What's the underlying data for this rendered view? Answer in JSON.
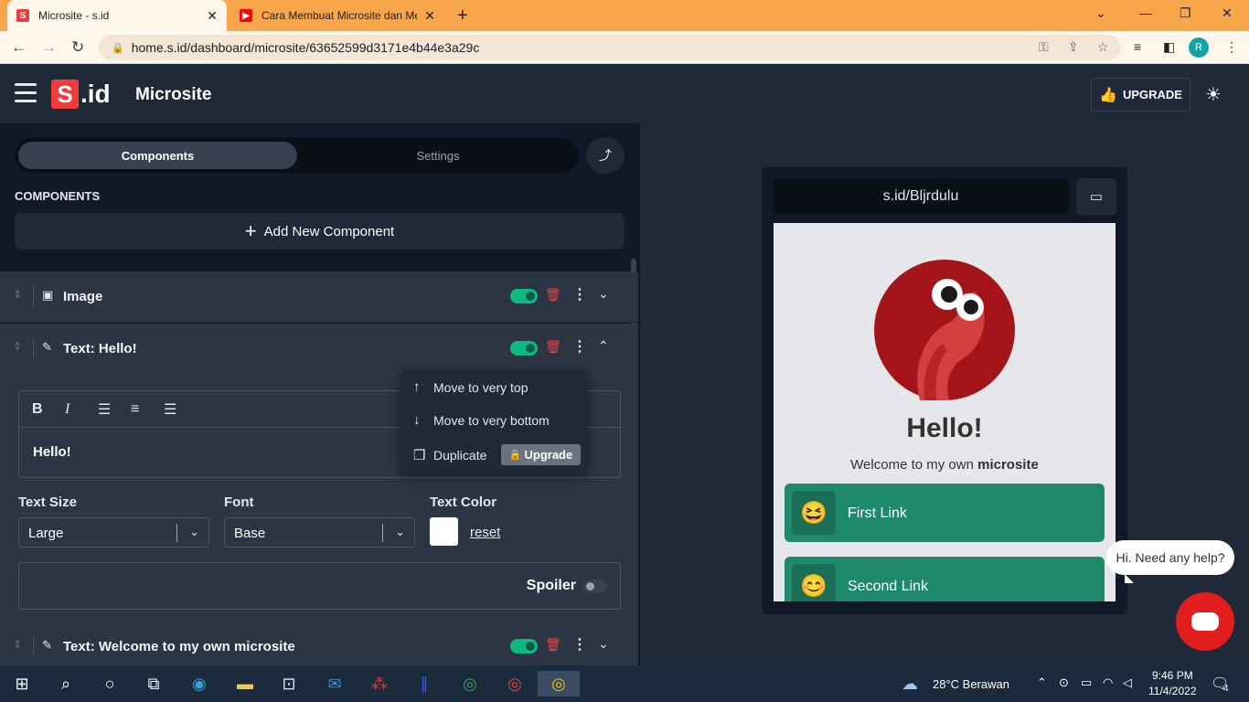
{
  "browser": {
    "tabs": [
      {
        "title": "Microsite - s.id",
        "favicon": "S",
        "favicon_color": "#ef3b3b"
      },
      {
        "title": "Cara Membuat Microsite dan Me",
        "favicon": "▶",
        "favicon_color": "#ff0000"
      }
    ],
    "url": "home.s.id/dashboard/microsite/63652599d3171e4b44e3a29c",
    "avatar_letter": "R"
  },
  "header": {
    "title": "Microsite",
    "logo_s": "S",
    "logo_id": ".id",
    "upgrade_label": "UPGRADE"
  },
  "panel": {
    "tabs": {
      "active": "Components",
      "inactive": "Settings"
    },
    "components_heading": "COMPONENTS",
    "add_button": "Add New Component",
    "rows": [
      {
        "label": "Image",
        "icon": "image-icon"
      },
      {
        "label": "Text: Hello!",
        "icon": "pencil-icon"
      },
      {
        "label": "Text: Welcome to my own microsite",
        "icon": "pencil-icon"
      }
    ],
    "editor_text": "Hello!",
    "text_size_label": "Text Size",
    "text_size_value": "Large",
    "font_label": "Font",
    "font_value": "Base",
    "text_color_label": "Text Color",
    "text_color_value": "#ffffff",
    "reset_label": "reset",
    "spoiler_label": "Spoiler"
  },
  "menu": {
    "move_top": "Move to very top",
    "move_bottom": "Move to very bottom",
    "duplicate": "Duplicate",
    "upgrade": "Upgrade"
  },
  "preview": {
    "url": "s.id/Bljrdulu",
    "heading": "Hello!",
    "welcome_prefix": "Welcome to my own ",
    "welcome_bold": "microsite",
    "links": [
      {
        "label": "First Link",
        "emoji": "😆"
      },
      {
        "label": "Second Link",
        "emoji": "😊"
      }
    ]
  },
  "chat": {
    "bubble": "Hi. Need any help?"
  },
  "taskbar": {
    "weather": "28°C  Berawan",
    "time": "9:46 PM",
    "date": "11/4/2022",
    "notifications": "4"
  },
  "colors": {
    "brand": "#ef3b3b",
    "accent_green": "#1e8a69",
    "toggle_on": "#10b981"
  }
}
